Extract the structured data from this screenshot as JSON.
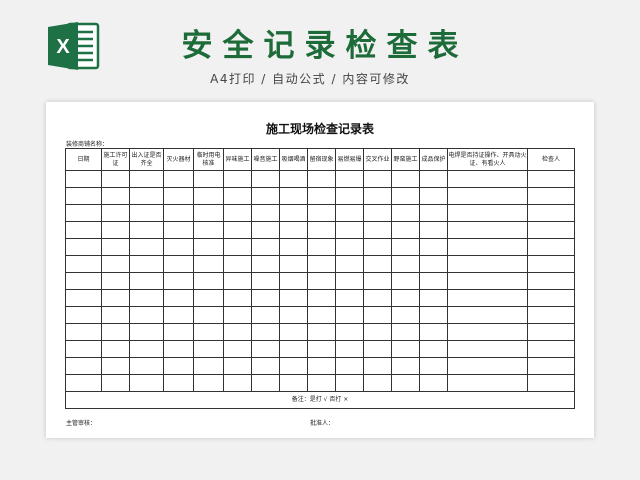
{
  "header": {
    "title": "安全记录检查表",
    "subtitle": "A4打印 / 自动公式 / 内容可修改",
    "logo_icon": "excel-icon",
    "brand_color": "#1e6b3a"
  },
  "sheet": {
    "title": "施工现场检查记录表",
    "shop_label": "装修商铺名称：",
    "columns": [
      "日期",
      "施工许可证",
      "出入证是否齐全",
      "灭火器材",
      "临时用电核准",
      "异味施工",
      "噪音施工",
      "吸烟喝酒",
      "留宿现象",
      "易燃易爆",
      "交叉作业",
      "野蛮施工",
      "成品保护",
      "电焊是否持证操作、开具动火证、有看火人",
      "检查人"
    ],
    "empty_row_count": 13,
    "note": "备注：是打 √      否打 ×",
    "footer_left": "主管审核：",
    "footer_right": "批准人："
  }
}
